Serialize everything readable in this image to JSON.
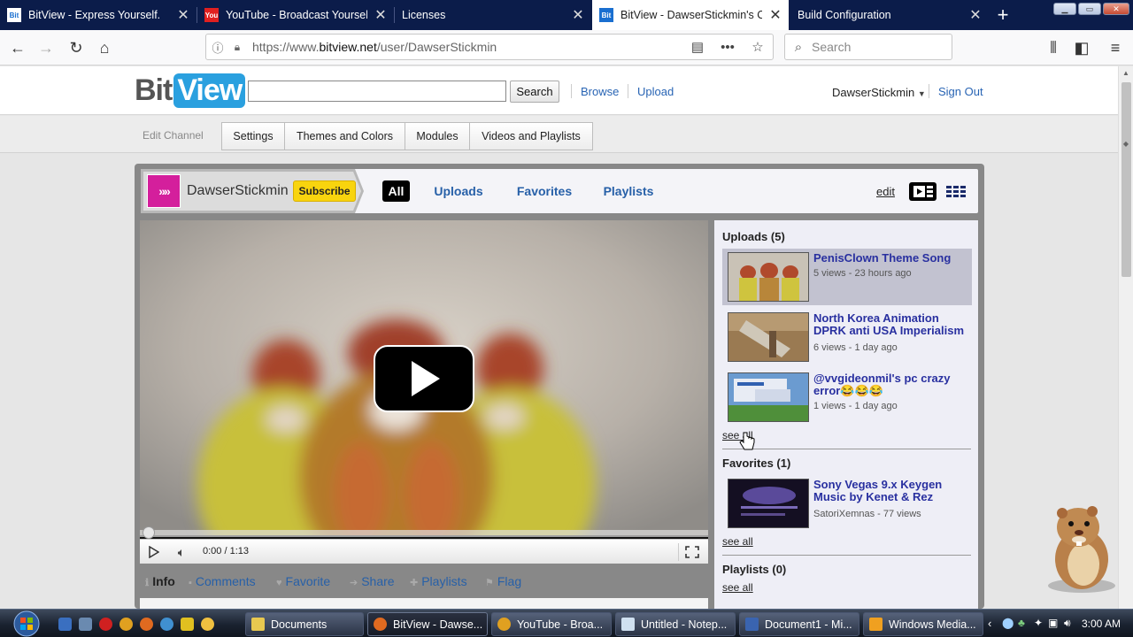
{
  "browser": {
    "tabs": [
      {
        "title": "BitView - Express Yourself.",
        "favicon": "bitview-favicon"
      },
      {
        "title": "YouTube - Broadcast Yourself.",
        "favicon": "youtube-favicon"
      },
      {
        "title": "Licenses",
        "favicon": ""
      },
      {
        "title": "BitView - DawserStickmin's Ch",
        "favicon": "bitview-favicon"
      },
      {
        "title": "Build Configuration",
        "favicon": ""
      }
    ],
    "active_tab": 3,
    "url_prefix": "https://www.",
    "url_host": "bitview.net",
    "url_path": "/user/DawserStickmin",
    "search_placeholder": "Search"
  },
  "site": {
    "logo_bit": "Bit",
    "logo_view": "View",
    "search_button": "Search",
    "nav": {
      "browse": "Browse",
      "upload": "Upload"
    },
    "username": "DawserStickmin",
    "sign_out": "Sign Out"
  },
  "edit_channel": {
    "label": "Edit Channel",
    "tabs": [
      "Settings",
      "Themes and Colors",
      "Modules",
      "Videos and Playlists"
    ]
  },
  "channel": {
    "name": "DawserStickmin",
    "subscribe": "Subscribe",
    "tabs": [
      "All",
      "Uploads",
      "Favorites",
      "Playlists"
    ],
    "active_tab": "All",
    "edit": "edit"
  },
  "player": {
    "time": "0:00 / 1:13",
    "progress": 0.0
  },
  "actions": {
    "info": "Info",
    "comments": "Comments",
    "favorite": "Favorite",
    "share": "Share",
    "playlists": "Playlists",
    "flag": "Flag"
  },
  "sidebar": {
    "uploads_heading": "Uploads (5)",
    "uploads": [
      {
        "title": "PenisClown Theme Song",
        "meta": "5 views - 23 hours ago"
      },
      {
        "title": "North Korea Animation DPRK anti USA Imperialism",
        "meta": "6 views - 1 day ago"
      },
      {
        "title": "@vvgideonmil's pc crazy error😂😂😂",
        "meta": "1 views - 1 day ago"
      }
    ],
    "uploads_see_all": "see all",
    "favorites_heading": "Favorites (1)",
    "favorites": [
      {
        "title": "Sony Vegas 9.x Keygen Music by Kenet & Rez",
        "meta": "SatoriXemnas - 77 views"
      }
    ],
    "favorites_see_all": "see all",
    "playlists_heading": "Playlists (0)",
    "playlists_see_all": "see all"
  },
  "taskbar": {
    "tasks": [
      "Documents",
      "BitView - Dawse...",
      "YouTube - Broa...",
      "Untitled - Notep...",
      "Document1 - Mi...",
      "Windows Media..."
    ],
    "active_task": 1,
    "clock": "3:00 AM"
  },
  "colors": {
    "tabstrip": "#0b1c4a",
    "link": "#2760a8",
    "subscribe": "#f8d40e",
    "avatar": "#d41f9c",
    "logo_blue": "#2aa0df"
  }
}
